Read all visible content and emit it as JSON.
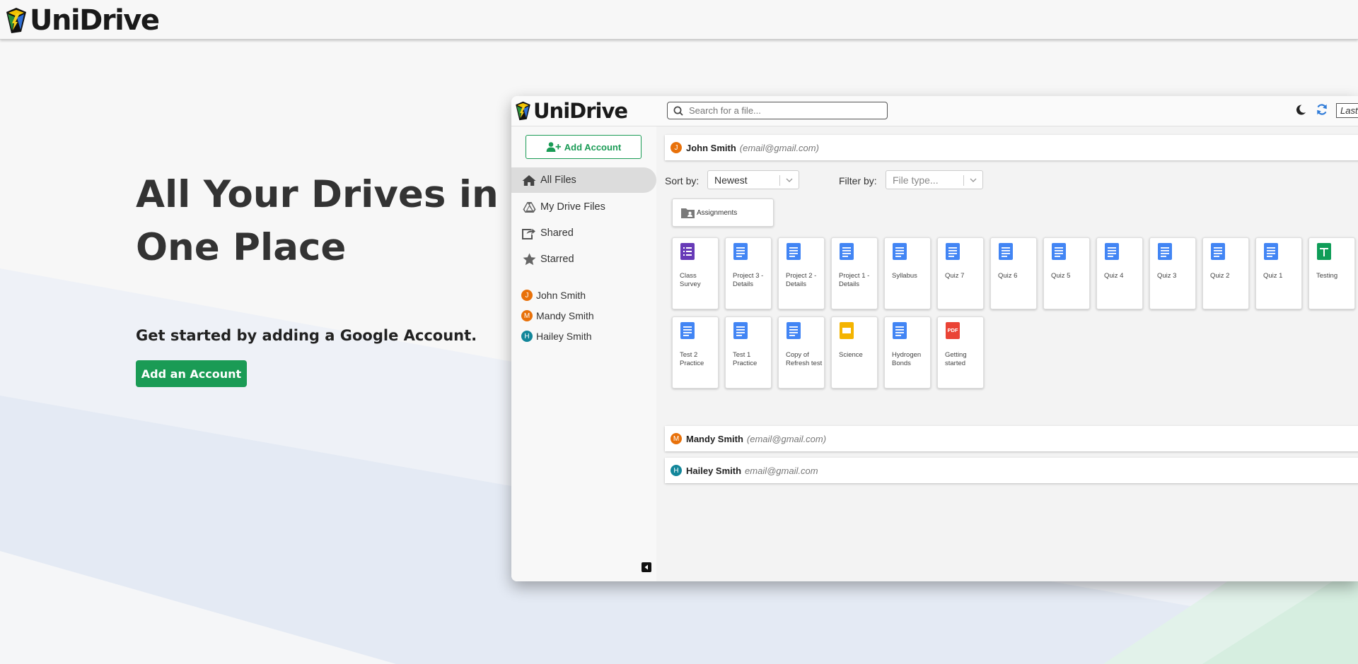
{
  "app": {
    "brand": "UniDrive"
  },
  "hero": {
    "title_line1": "All Your Drives in",
    "title_line2": "One Place",
    "subtitle": "Get started by adding a Google Account.",
    "cta_label": "Add an Account"
  },
  "colors": {
    "accent_green": "#1a9b55",
    "doc_blue": "#4285f4",
    "form_purple": "#673ab7",
    "sheet_green": "#0f9d58",
    "slide_yellow": "#f4b400",
    "pdf_red": "#ea4335"
  },
  "preview": {
    "brand": "UniDrive",
    "search_placeholder": "Search for a file...",
    "last_label": "Last",
    "sidebar": {
      "add_account_label": "Add Account",
      "nav": [
        {
          "label": "All Files",
          "icon": "home-icon"
        },
        {
          "label": "My Drive Files",
          "icon": "drive-icon"
        },
        {
          "label": "Shared",
          "icon": "share-icon"
        },
        {
          "label": "Starred",
          "icon": "star-icon"
        }
      ],
      "accounts": [
        {
          "initial": "J",
          "name": "John Smith",
          "color": "#e8710a"
        },
        {
          "initial": "M",
          "name": "Mandy Smith",
          "color": "#e8710a"
        },
        {
          "initial": "H",
          "name": "Hailey Smith",
          "color": "#12869a"
        }
      ]
    },
    "main": {
      "account1": {
        "initial": "J",
        "name": "John Smith",
        "email": "(email@gmail.com)"
      },
      "sort_label": "Sort by:",
      "sort_value": "Newest",
      "filter_label": "Filter by:",
      "filter_placeholder": "File type...",
      "folder": "Assignments",
      "files_row1": [
        {
          "name": "Class Survey",
          "type": "form"
        },
        {
          "name": "Project 3 - Details",
          "type": "doc"
        },
        {
          "name": "Project 2 - Details",
          "type": "doc"
        },
        {
          "name": "Project 1 - Details",
          "type": "doc"
        },
        {
          "name": "Syllabus",
          "type": "doc"
        },
        {
          "name": "Quiz 7",
          "type": "doc"
        },
        {
          "name": "Quiz 6",
          "type": "doc"
        },
        {
          "name": "Quiz 5",
          "type": "doc"
        },
        {
          "name": "Quiz 4",
          "type": "doc"
        },
        {
          "name": "Quiz 3",
          "type": "doc"
        },
        {
          "name": "Quiz 2",
          "type": "doc"
        },
        {
          "name": "Quiz 1",
          "type": "doc"
        },
        {
          "name": "Testing",
          "type": "sheet"
        }
      ],
      "files_row2": [
        {
          "name": "Test 2 Practice",
          "type": "doc"
        },
        {
          "name": "Test 1 Practice",
          "type": "doc"
        },
        {
          "name": "Copy of Refresh test",
          "type": "doc"
        },
        {
          "name": "Science",
          "type": "slide"
        },
        {
          "name": "Hydrogen Bonds",
          "type": "doc"
        },
        {
          "name": "Getting started",
          "type": "pdf"
        }
      ],
      "account2": {
        "initial": "M",
        "name": "Mandy Smith",
        "email": "(email@gmail.com)"
      },
      "account3": {
        "initial": "H",
        "name": "Hailey Smith",
        "email": "email@gmail.com"
      }
    }
  }
}
